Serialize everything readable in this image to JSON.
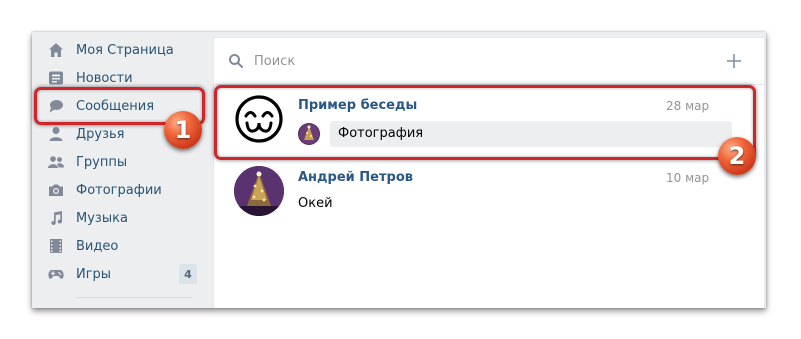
{
  "sidebar": {
    "items": [
      {
        "label": "Моя Страница",
        "icon": "home-icon"
      },
      {
        "label": "Новости",
        "icon": "news-icon"
      },
      {
        "label": "Сообщения",
        "icon": "messages-icon"
      },
      {
        "label": "Друзья",
        "icon": "friends-icon"
      },
      {
        "label": "Группы",
        "icon": "groups-icon"
      },
      {
        "label": "Фотографии",
        "icon": "photos-icon"
      },
      {
        "label": "Музыка",
        "icon": "music-icon"
      },
      {
        "label": "Видео",
        "icon": "video-icon"
      },
      {
        "label": "Игры",
        "icon": "games-icon",
        "badge": "4"
      }
    ]
  },
  "search": {
    "placeholder": "Поиск"
  },
  "dialogs": [
    {
      "name": "Пример беседы",
      "date": "28 мар",
      "preview": "Фотография"
    },
    {
      "name": "Андрей Петров",
      "date": "10 мар",
      "preview": "Окей"
    }
  ],
  "annotations": {
    "marker_1": "1",
    "marker_2": "2"
  },
  "colors": {
    "link": "#285473",
    "name": "#2a5885",
    "highlight": "#d2242b",
    "icon": "#828a99"
  }
}
